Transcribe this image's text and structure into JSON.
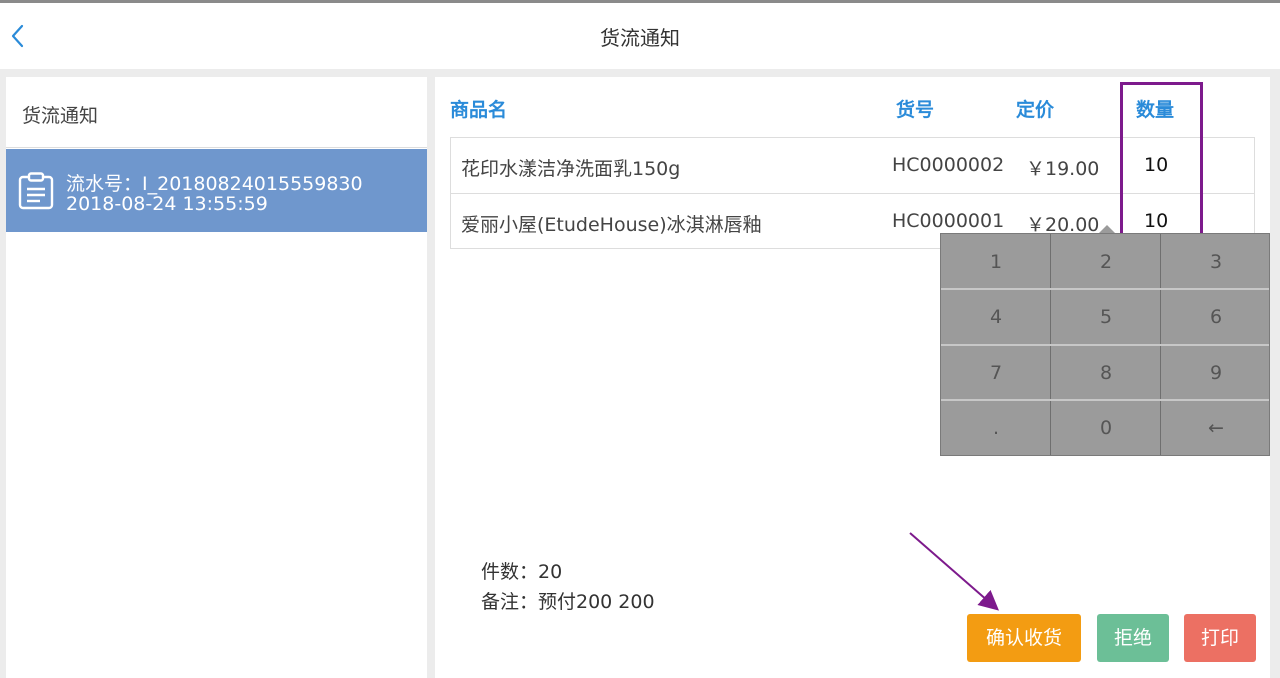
{
  "header": {
    "title": "货流通知"
  },
  "sidebar": {
    "title": "货流通知",
    "items": [
      {
        "serial": "流水号：I_20180824015559830",
        "datetime": "2018-08-24 13:55:59"
      }
    ]
  },
  "table": {
    "headers": {
      "name": "商品名",
      "code": "货号",
      "price": "定价",
      "qty": "数量"
    },
    "rows": [
      {
        "name": "花印水漾洁净洗面乳150g",
        "code": "HC0000002",
        "price": "￥19.00",
        "qty": "10"
      },
      {
        "name": "爱丽小屋(EtudeHouse)冰淇淋唇釉",
        "code": "HC0000001",
        "price": "￥20.00",
        "qty": "10"
      }
    ]
  },
  "keypad": {
    "keys": [
      "1",
      "2",
      "3",
      "4",
      "5",
      "6",
      "7",
      "8",
      "9",
      ".",
      "0",
      "←"
    ]
  },
  "summary": {
    "count_text": "件数：20",
    "note_text": "备注：预付200 200"
  },
  "buttons": {
    "confirm": "确认收货",
    "reject": "拒绝",
    "print": "打印"
  },
  "colors": {
    "accent_blue": "#2a8bd9",
    "selected_item": "#6f97cd",
    "confirm": "#f39c12",
    "reject": "#6cbf97",
    "print": "#ec7063",
    "annotation": "#7d1a8c"
  }
}
